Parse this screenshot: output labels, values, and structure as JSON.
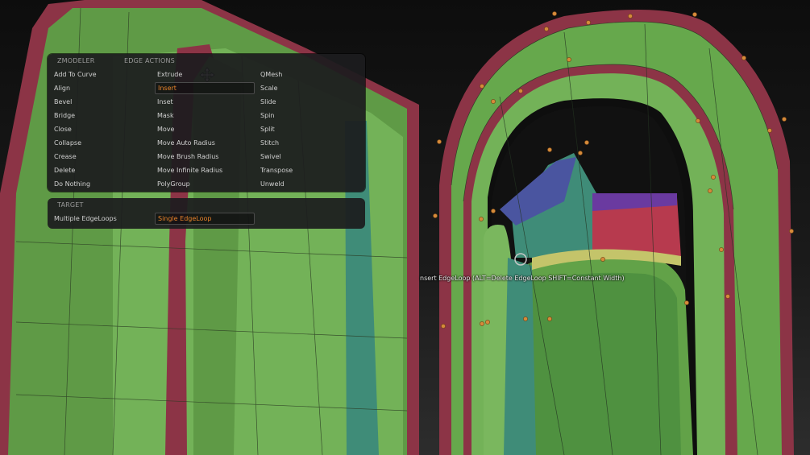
{
  "zmodeler_menu": {
    "header_left": "ZMODELER",
    "header_right": "EDGE ACTIONS",
    "col1": [
      "Add To Curve",
      "Align",
      "Bevel",
      "Bridge",
      "Close",
      "Collapse",
      "Crease",
      "Delete",
      "Do Nothing"
    ],
    "col2": [
      "Extrude",
      "Insert",
      "Inset",
      "Mask",
      "Move",
      "Move Auto Radius",
      "Move Brush Radius",
      "Move Infinite Radius",
      "PolyGroup"
    ],
    "col3": [
      "QMesh",
      "Scale",
      "Slide",
      "Spin",
      "Split",
      "Stitch",
      "Swivel",
      "Transpose",
      "Unweld"
    ],
    "selected_action": "Insert"
  },
  "target_menu": {
    "header": "TARGET",
    "options": [
      "Multiple EdgeLoops",
      "Single EdgeLoop"
    ],
    "selected_target": "Single EdgeLoop"
  },
  "tooltip": {
    "text": "nsert EdgeLoop (ALT=Delete EdgeLoop SHIFT=Constant Width)"
  },
  "colors": {
    "accent": "#e8822a",
    "mesh_green": "#6cab4e",
    "mesh_maroon": "#8c3446",
    "mesh_teal": "#3f8c78",
    "mesh_blue": "#4a55a0",
    "mesh_red": "#b73a4e",
    "vertex_dot": "#d58a3a"
  },
  "icons": {
    "cursor": "move-cursor-icon"
  }
}
